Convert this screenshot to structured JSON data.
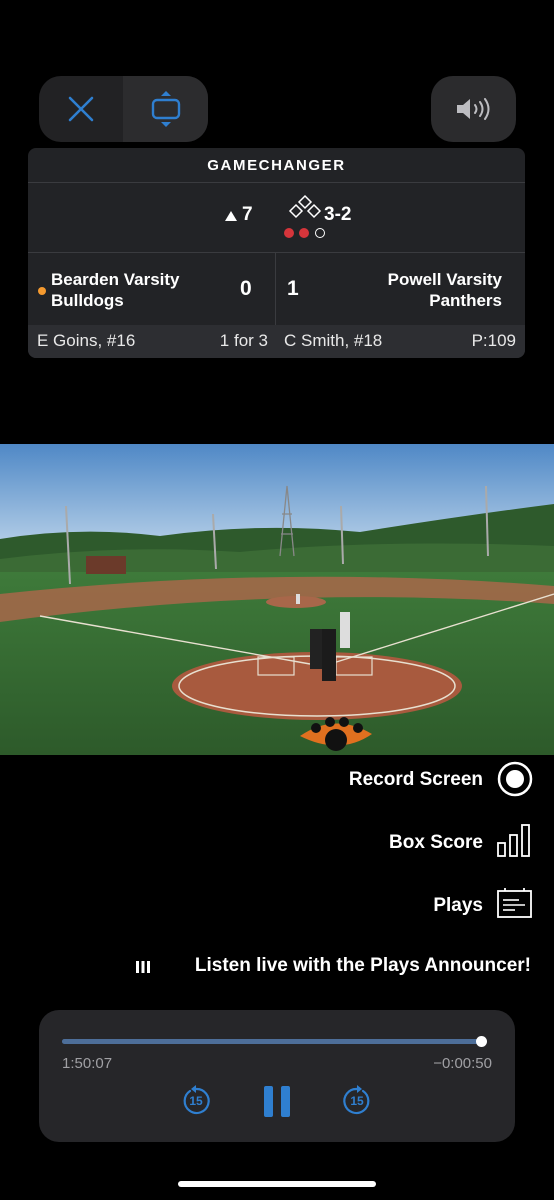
{
  "controls": {
    "close_icon": "close-icon",
    "resize_icon": "resize-icon",
    "volume_icon": "speaker-volume-icon",
    "accent": "#2f7fd0"
  },
  "scoreboard": {
    "brand": "GAMECHANGER",
    "inning": "7",
    "inning_half": "top",
    "count": "3-2",
    "outs": 2,
    "outs_max": 3,
    "away": {
      "name": "Bearden Varsity Bulldogs",
      "score": "0",
      "batting_indicator_color": "#f59a2f"
    },
    "home": {
      "name": "Powell Varsity Panthers",
      "score": "1"
    },
    "batter": {
      "name": "E Goins, #16",
      "stat": "1 for 3"
    },
    "pitcher": {
      "name": "C Smith, #18",
      "stat": "P:109"
    },
    "out_color": "#d6353b"
  },
  "actions": {
    "record_screen": "Record Screen",
    "box_score": "Box Score",
    "plays": "Plays",
    "announcer": "Listen live with the Plays Announcer!"
  },
  "player": {
    "elapsed": "1:50:07",
    "remaining": "−0:00:50",
    "progress": 0.9925,
    "rewind_seconds": "15",
    "forward_seconds": "15",
    "accent": "#2f7fd0"
  }
}
